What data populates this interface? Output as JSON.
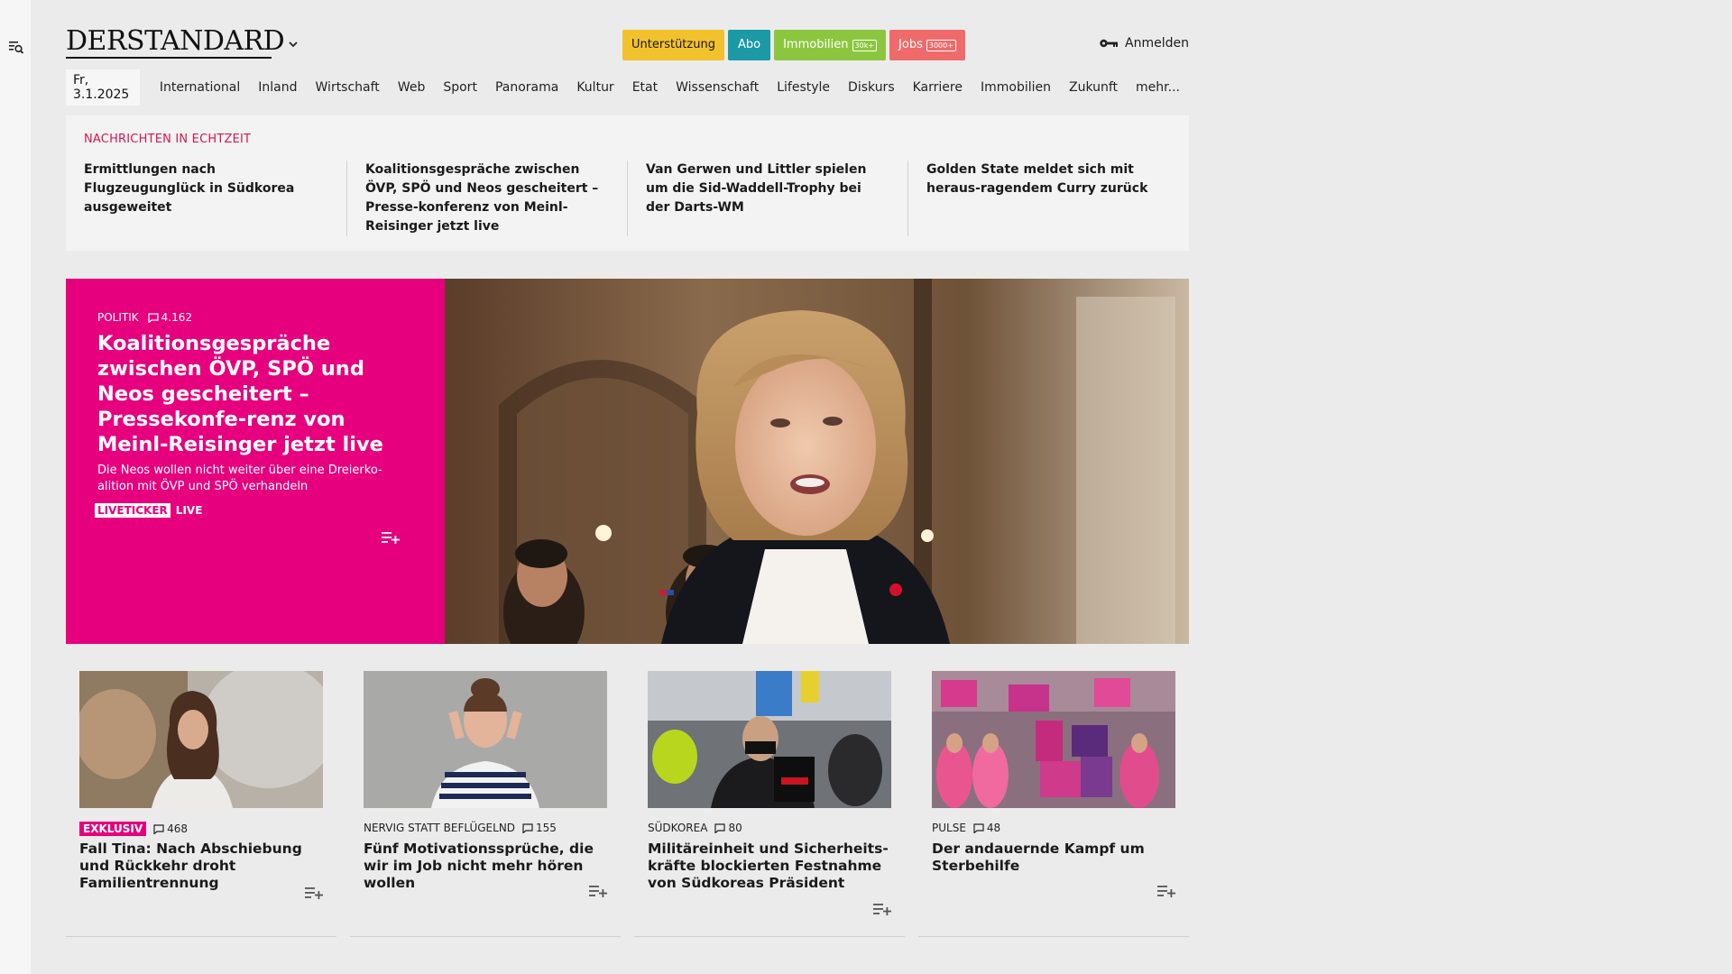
{
  "header": {
    "logo": "DERSTANDARD",
    "buttons": {
      "support": "Unterstützung",
      "abo": "Abo",
      "immobilien": "Immobilien",
      "immobilien_tag": "30k+",
      "jobs": "Jobs",
      "jobs_tag": "3000+"
    },
    "login": "Anmelden"
  },
  "nav": {
    "date": "Fr, 3.1.2025",
    "items": [
      "International",
      "Inland",
      "Wirtschaft",
      "Web",
      "Sport",
      "Panorama",
      "Kultur",
      "Etat",
      "Wissenschaft",
      "Lifestyle",
      "Diskurs",
      "Karriere",
      "Immobilien",
      "Zukunft",
      "mehr..."
    ]
  },
  "ticker": {
    "heading": "NACHRICHTEN IN ECHTZEIT",
    "items": [
      "Ermittlungen nach Flugzeugunglück in Südkorea ausgeweitet",
      "Koalitionsgespräche zwischen ÖVP, SPÖ und Neos gescheitert – Presse-konferenz von Meinl-Reisinger jetzt live",
      "Van Gerwen und Littler spielen um die Sid-Waddell-Trophy bei der Darts-WM",
      "Golden State meldet sich mit heraus-ragendem Curry zurück"
    ]
  },
  "hero": {
    "category": "POLITIK",
    "comments": "4.162",
    "title": "Koalitionsgespräche zwischen ÖVP, SPÖ und Neos gescheitert – Pressekonfe-renz von Meinl-Reisinger jetzt live",
    "description": "Die Neos wollen nicht weiter über eine Dreierko-alition mit ÖVP und SPÖ verhandeln",
    "liveticker": "LIVETICKER",
    "live": "LIVE"
  },
  "cards": [
    {
      "badge": "EXKLUSIV",
      "category": "",
      "comments": "468",
      "title": "Fall Tina: Nach Abschiebung und Rückkehr droht Familientrennung"
    },
    {
      "badge": "",
      "category": "NERVIG STATT BEFLÜGELND",
      "comments": "155",
      "title": "Fünf Motivationssprüche, die wir im Job nicht mehr hören wollen"
    },
    {
      "badge": "",
      "category": "SÜDKOREA",
      "comments": "80",
      "title": "Militäreinheit und Sicherheits-kräfte blockierten Festnahme von Südkoreas Präsident"
    },
    {
      "badge": "",
      "category": "PULSE",
      "comments": "48",
      "title": "Der andauernde Kampf um Sterbehilfe"
    }
  ],
  "icons": {
    "menu_search": "menu-search-icon",
    "chevron": "chevron-down-icon",
    "key": "key-icon",
    "comment": "comment-icon",
    "add_playlist": "add-to-list-icon"
  },
  "colors": {
    "accent_pink": "#e6007e",
    "ticker_red": "#d6174f",
    "support": "#f2c12e",
    "abo": "#1b9aa6",
    "immobilien": "#8cc63f",
    "jobs": "#ef6b6b"
  }
}
